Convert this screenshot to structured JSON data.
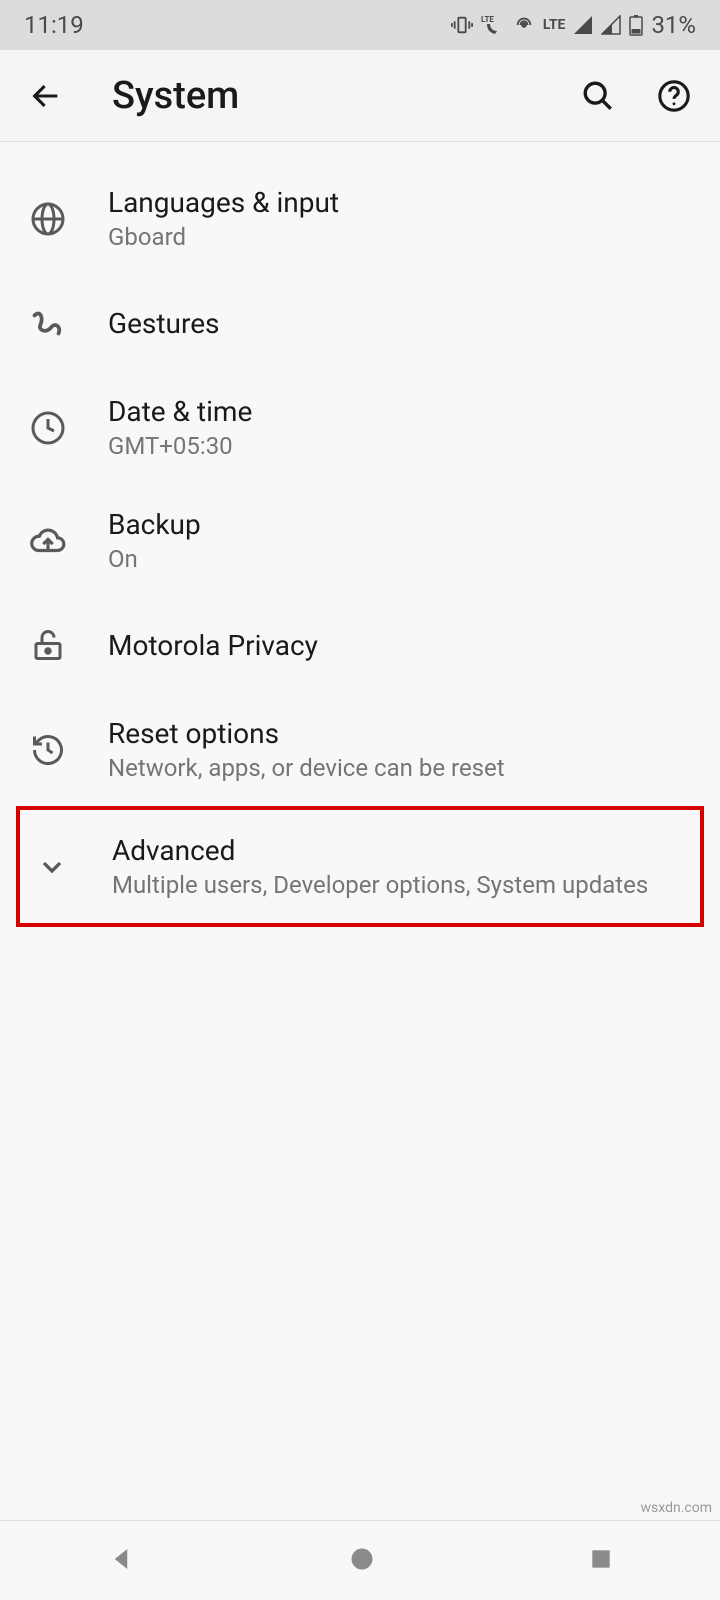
{
  "status": {
    "time": "11:19",
    "network_label": "LTE",
    "battery": "31%"
  },
  "header": {
    "title": "System"
  },
  "items": [
    {
      "title": "Languages & input",
      "subtitle": "Gboard"
    },
    {
      "title": "Gestures",
      "subtitle": ""
    },
    {
      "title": "Date & time",
      "subtitle": "GMT+05:30"
    },
    {
      "title": "Backup",
      "subtitle": "On"
    },
    {
      "title": "Motorola Privacy",
      "subtitle": ""
    },
    {
      "title": "Reset options",
      "subtitle": "Network, apps, or device can be reset"
    },
    {
      "title": "Advanced",
      "subtitle": "Multiple users, Developer options, System updates"
    }
  ],
  "watermark": "wsxdn.com"
}
